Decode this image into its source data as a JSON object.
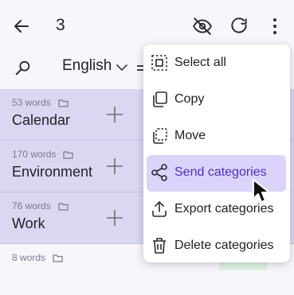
{
  "header": {
    "count": "3",
    "icons": [
      "back-arrow-icon",
      "eye-off-icon",
      "refresh-icon",
      "more-vert-icon"
    ]
  },
  "filter": {
    "language": "English"
  },
  "categories": [
    {
      "words": "53 words",
      "name": "Calendar",
      "selected": true
    },
    {
      "words": "170 words",
      "name": "Environment",
      "selected": true
    },
    {
      "words": "76 words",
      "name": "Work",
      "selected": true
    },
    {
      "words": "8 words",
      "name": "",
      "selected": false
    }
  ],
  "menu": {
    "items": [
      {
        "label": "Select all",
        "icon": "select-all-icon"
      },
      {
        "label": "Copy",
        "icon": "copy-icon"
      },
      {
        "label": "Move",
        "icon": "move-icon"
      },
      {
        "label": "Send categories",
        "icon": "share-icon",
        "active": true
      },
      {
        "label": "Export categories",
        "icon": "export-icon"
      },
      {
        "label": "Delete categories",
        "icon": "trash-icon"
      }
    ]
  },
  "colors": {
    "background": "#f7f6fb",
    "selected_row": "#d9d7f2",
    "menu_highlight": "#dcd3fb",
    "accent_text": "#4a2fc4"
  }
}
